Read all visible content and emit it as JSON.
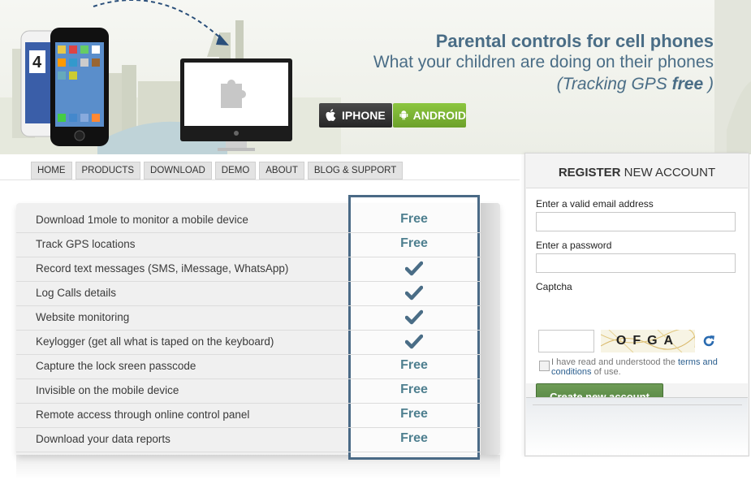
{
  "hero": {
    "title": "Parental controls for cell phones",
    "subtitle": "What your children are doing on their phones",
    "tracking_prefix": "(Tracking GPS ",
    "tracking_bold": "free",
    "tracking_suffix": " )",
    "phone_screen_number": "4",
    "buttons": {
      "iphone": "IPHONE",
      "android": "ANDROID"
    }
  },
  "nav": [
    "HOME",
    "PRODUCTS",
    "DOWNLOAD",
    "DEMO",
    "ABOUT",
    "BLOG & SUPPORT"
  ],
  "features": [
    {
      "label": "Download 1mole to monitor a mobile device",
      "value": "Free"
    },
    {
      "label": "Track GPS locations",
      "value": "Free"
    },
    {
      "label": "Record text messages (SMS, iMessage, WhatsApp)",
      "value": "check"
    },
    {
      "label": "Log Calls details",
      "value": "check"
    },
    {
      "label": "Website monitoring",
      "value": "check"
    },
    {
      "label": "Keylogger (get all what is taped on the keyboard)",
      "value": "check"
    },
    {
      "label": "Capture the lock sreen passcode",
      "value": "Free"
    },
    {
      "label": "Invisible on the mobile device",
      "value": "Free"
    },
    {
      "label": "Remote access through online control panel",
      "value": "Free"
    },
    {
      "label": "Download your data reports",
      "value": "Free"
    }
  ],
  "register": {
    "title_bold": "REGISTER",
    "title_rest": " NEW ACCOUNT",
    "email_label": "Enter a valid email address",
    "email_value": "",
    "password_label": "Enter a password",
    "password_value": "",
    "captcha_label": "Captcha",
    "captcha_input": "",
    "captcha_text": "OFGA",
    "terms_prefix": "I have read and understood the ",
    "terms_link": "terms and conditions",
    "terms_suffix": " of use.",
    "submit": "Create new account"
  },
  "colors": {
    "accent": "#4a6d86",
    "free": "#4e7f8f",
    "button_green": "#5a8a44",
    "android": "#7cb335"
  }
}
